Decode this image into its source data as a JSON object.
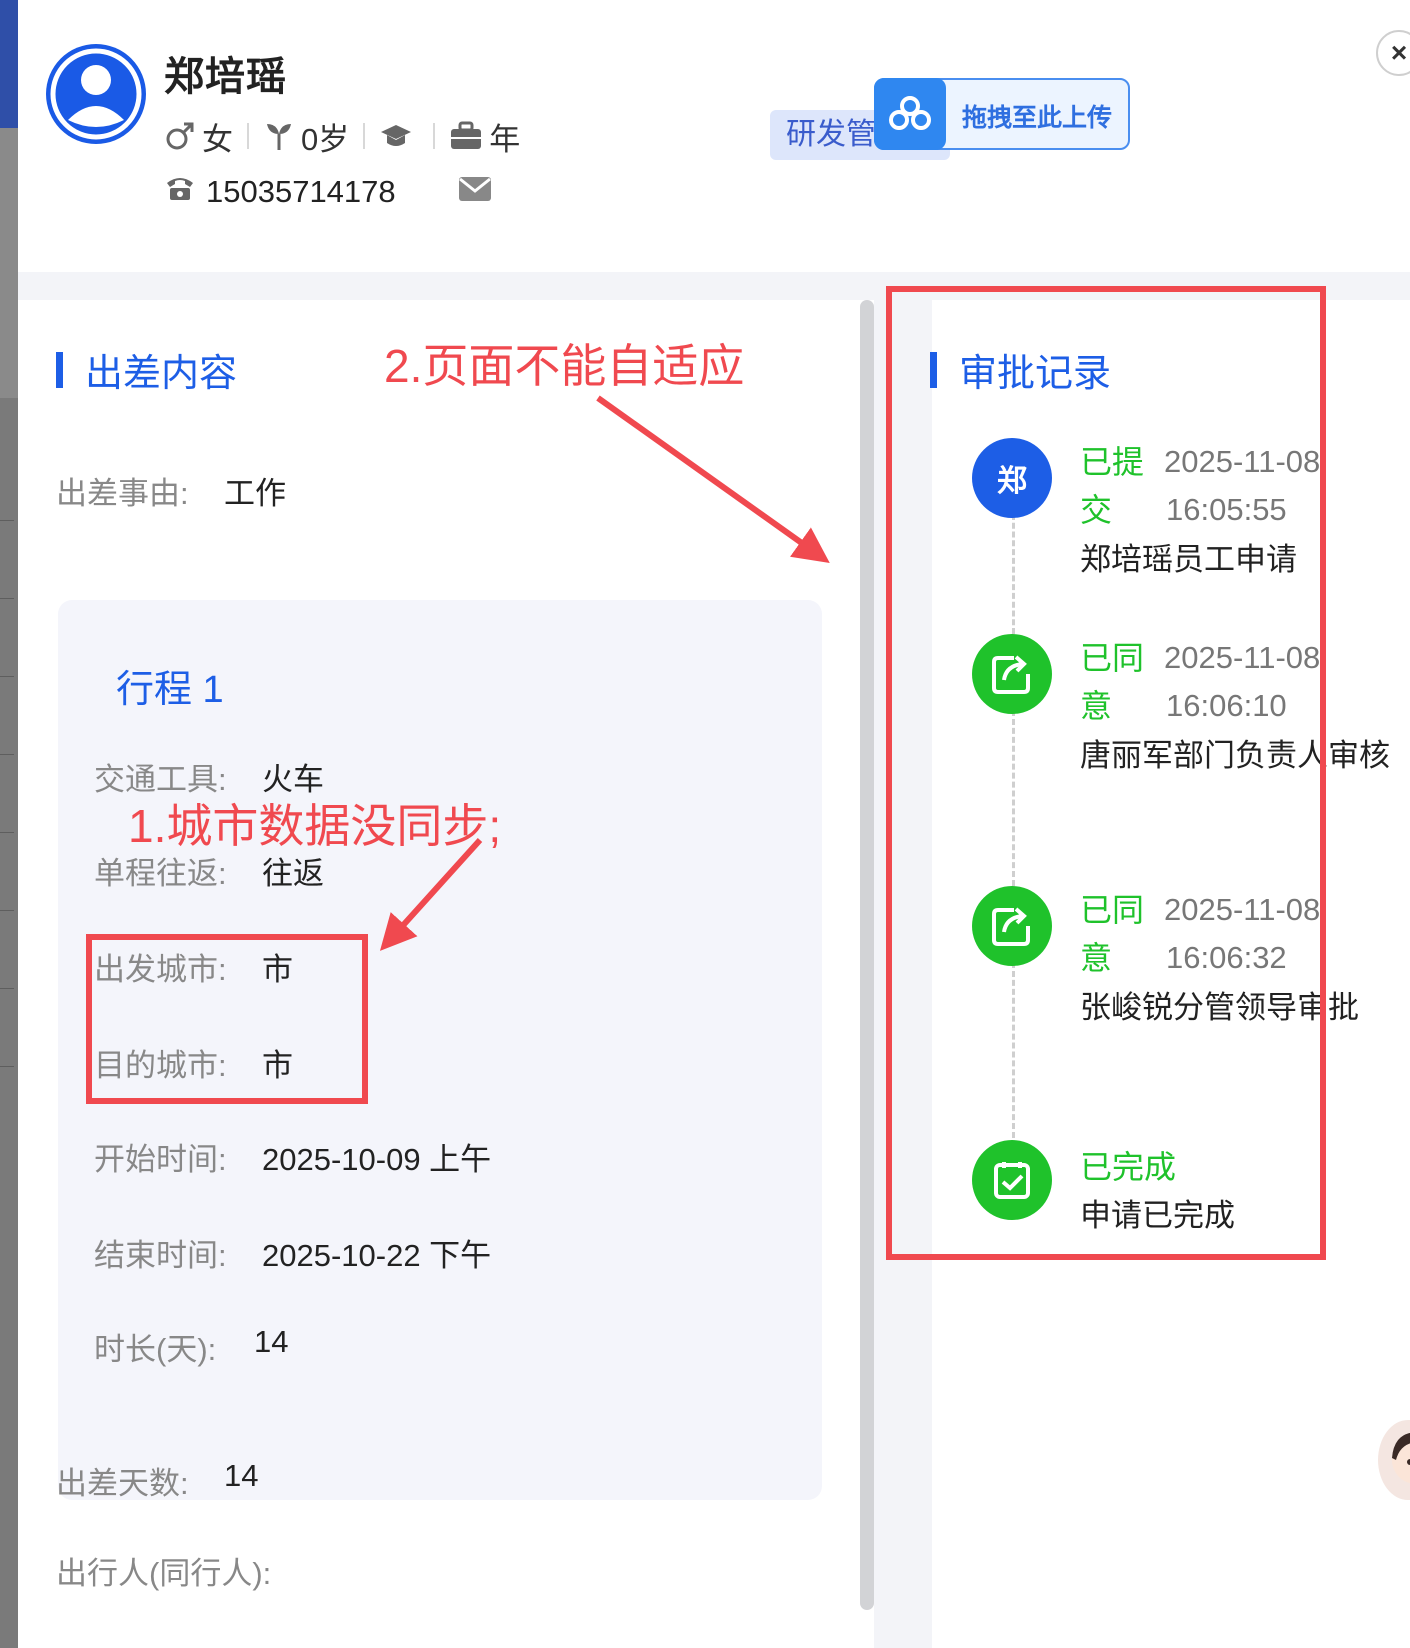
{
  "profile": {
    "name": "郑培瑶",
    "gender": "女",
    "age": "0岁",
    "years": "年",
    "phone": "15035714178",
    "dept": "研发管"
  },
  "upload": {
    "label": "拖拽至此上传"
  },
  "close": {
    "label": "×"
  },
  "content": {
    "title": "出差内容",
    "reason_label": "出差事由:",
    "reason_value": "工作",
    "trip": {
      "title": "行程 1",
      "transport_label": "交通工具:",
      "transport_value": "火车",
      "oneway_label": "单程往返:",
      "oneway_value": "往返",
      "from_label": "出发城市:",
      "from_value": "市",
      "to_label": "目的城市:",
      "to_value": "市",
      "start_label": "开始时间:",
      "start_value": "2025-10-09 上午",
      "end_label": "结束时间:",
      "end_value": "2025-10-22 下午",
      "duration_label": "时长(天):",
      "duration_value": "14"
    },
    "days_label": "出差天数:",
    "days_value": "14",
    "companion_label": "出行人(同行人):"
  },
  "annotations": {
    "note1": "1.城市数据没同步;",
    "note2": "2.页面不能自适应"
  },
  "approval": {
    "title": "审批记录",
    "records": [
      {
        "avatar": "郑",
        "status": "已提交",
        "date": "2025-11-08",
        "time": "16:05:55",
        "desc": "郑培瑶员工申请",
        "color": "#1d5ee6"
      },
      {
        "status": "已同意",
        "date": "2025-11-08",
        "time": "16:06:10",
        "desc": "唐丽军部门负责人审核",
        "color": "#1fc22b"
      },
      {
        "status": "已同意",
        "date": "2025-11-08",
        "time": "16:06:32",
        "desc": "张峻锐分管领导审批",
        "color": "#1fc22b"
      },
      {
        "status": "已完成",
        "desc": "申请已完成",
        "color": "#1fc22b"
      }
    ]
  },
  "colors": {
    "accent": "#1d5ee6",
    "success": "#1fc22b",
    "annotation": "#f0494f"
  }
}
